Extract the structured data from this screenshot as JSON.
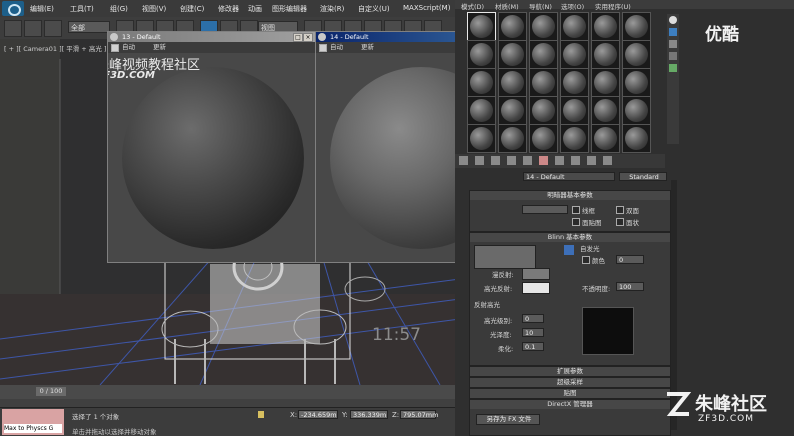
{
  "menubar": {
    "items": [
      "编辑(E)",
      "工具(T)",
      "组(G)",
      "视图(V)",
      "创建(C)",
      "修改器",
      "动画",
      "图形编辑器",
      "渲染(R)",
      "自定义(U)",
      "MAXScript(M)"
    ]
  },
  "toolbar": {
    "filter_select": "全部",
    "refcoord_select": "视图"
  },
  "viewport": {
    "label": "[ + ][ Camera01 ][ 平滑 + 高光 ]",
    "timer": "11:57"
  },
  "material_window_13": {
    "title": "13 - Default",
    "auto_label": "自动",
    "update_label": "更新"
  },
  "material_window_14": {
    "title": "14 - Default",
    "auto_label": "自动",
    "update_label": "更新"
  },
  "watermark": {
    "cn": "朱峰视频教程社区",
    "en": "ZF3D.COM"
  },
  "material_editor": {
    "menu": [
      "模式(D)",
      "材质(M)",
      "导航(N)",
      "选项(O)",
      "实用程序(U)"
    ],
    "material_name": "14 - Default",
    "material_type": "Standard",
    "shader_rollout": "明暗器基本参数",
    "shader_options": [
      "线框",
      "双面",
      "面贴图",
      "面状"
    ],
    "blinn_rollout": "Blinn 基本参数",
    "self_illum": "自发光",
    "color_label": "颜色",
    "color_value": "0",
    "diffuse_label": "漫反射:",
    "specular_label": "高光反射:",
    "opacity_label": "不透明度:",
    "opacity_value": "100",
    "spec_highlights": "反射高光",
    "spec_level_label": "高光级别:",
    "spec_level_value": "0",
    "glossiness_label": "光泽度:",
    "glossiness_value": "10",
    "soften_label": "柔化:",
    "soften_value": "0.1",
    "collapsed_rollouts": [
      "扩展参数",
      "超级采样",
      "贴图",
      "DirectX 管理器"
    ],
    "fx_button": "另存为 FX 文件"
  },
  "timeline": {
    "frame": "0 / 100"
  },
  "status": {
    "selection": "选择了 1 个对象",
    "hint": "单击并拖动以选择并移动对象",
    "script_field": "Max to Physcs G",
    "x_label": "X:",
    "x_value": "-234.659m",
    "y_label": "Y:",
    "y_value": "336.339m",
    "z_label": "Z:",
    "z_value": "795.07mm"
  },
  "branding": {
    "top_right": "优酷",
    "bottom_right_cn": "朱峰社区",
    "bottom_right_en": "ZF3D.COM"
  },
  "colors": {
    "title_active": "#0a246a",
    "panel_bg": "#2f2f2f",
    "window_face": "#d4d0c8"
  }
}
